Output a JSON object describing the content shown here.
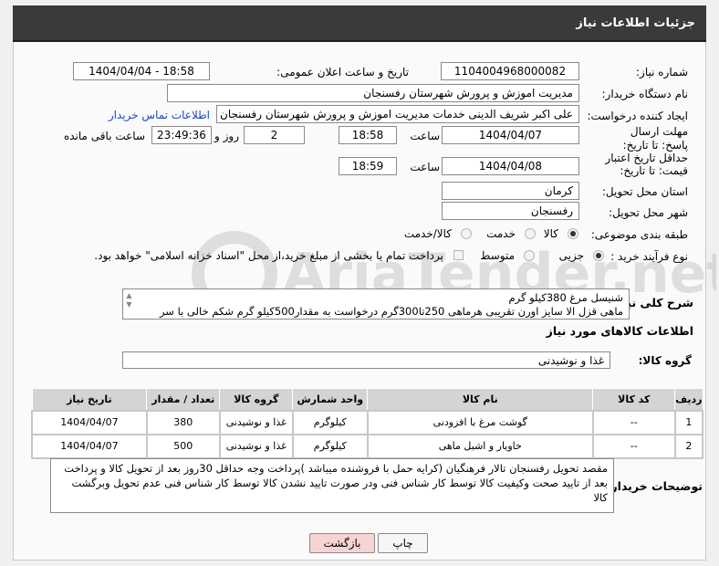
{
  "header": {
    "title": "جزئیات اطلاعات نیاز"
  },
  "form": {
    "need_number_label": "شماره نیاز:",
    "need_number": "1104004968000082",
    "announce_label": "تاریخ و ساعت اعلان عمومی:",
    "announce_value": "1404/04/04 - 18:58",
    "buyer_org_label": "نام دستگاه خریدار:",
    "buyer_org": "مدیریت اموزش و پرورش شهرستان رفسنجان",
    "creator_label": "ایجاد کننده درخواست:",
    "creator": "علی اکبر شریف الدینی خدمات مدیریت اموزش و پرورش شهرستان رفسنجان",
    "contact_link": "اطلاعات تماس خریدار",
    "send_deadline_label": "مهلت ارسال پاسخ: تا تاریخ:",
    "send_deadline_date": "1404/04/07",
    "hour_label": "ساعت",
    "send_deadline_time": "18:58",
    "days_value": "2",
    "day_and_label": "روز و",
    "remaining_time": "23:49:36",
    "remaining_label": "ساعت باقی مانده",
    "price_validity_label": "حداقل تاریخ اعتبار قیمت: تا تاریخ:",
    "price_validity_date": "1404/04/08",
    "hour_label2": "ساعت",
    "price_validity_time": "18:59",
    "province_label": "استان محل تحویل:",
    "province": "کرمان",
    "city_label": "شهر محل تحویل:",
    "city": "رفسنجان",
    "category_label": "طبقه بندی موضوعی:",
    "category_options": [
      "کالا",
      "خدمت",
      "کالا/خدمت"
    ],
    "process_label": "نوع فرآیند خرید :",
    "process_options": [
      "جزیی",
      "متوسط"
    ],
    "payment_note": "پرداخت تمام یا بخشی از مبلغ خرید،از محل \"اسناد خزانه اسلامی\" خواهد بود."
  },
  "description": {
    "label": "شرح کلی نیاز:",
    "line1": "شنیسل مرغ  380کیلو گرم",
    "line2": "ماهی قزل الا سایز اورن تقریبی هرماهی 250تا300گرم درخواست به مقدار500کیلو گرم شکم خالی با سر"
  },
  "goods_section": {
    "title": "اطلاعات کالاهای مورد نیاز",
    "group_label": "گروه کالا:",
    "group_value": "غذا و نوشیدنی"
  },
  "table": {
    "headers": [
      "ردیف",
      "کد کالا",
      "نام کالا",
      "واحد شمارش",
      "گروه کالا",
      "تعداد / مقدار",
      "تاریخ نیاز"
    ],
    "rows": [
      [
        "1",
        "--",
        "گوشت مرغ با افزودنی",
        "کیلوگرم",
        "غذا و نوشیدنی",
        "380",
        "1404/04/07"
      ],
      [
        "2",
        "--",
        "خاویار و اشبل ماهی",
        "کیلوگرم",
        "غذا و نوشیدنی",
        "500",
        "1404/04/07"
      ]
    ]
  },
  "buyer_notes": {
    "label": "توضیحات خریدار:",
    "text": "مقصد تحویل رفسنجان تالار فرهنگیان (کرایه حمل با فروشنده میباشد )پرداخت وجه حداقل 30روز بعد از تحویل کالا و پرداخت بعد از تایید صحت وکیفیت کالا توسط کار شناس فنی ودر صورت تایید نشدن کالا توسط کار شناس فنی عدم تحویل وبرگشت کالا"
  },
  "buttons": {
    "print": "چاپ",
    "back": "بازگشت"
  },
  "watermark": "AriaTender.net",
  "colors": {
    "title_bg": "#3a3a3a",
    "back_button_bg": "#f7d4d4",
    "link": "#1a47c8"
  }
}
